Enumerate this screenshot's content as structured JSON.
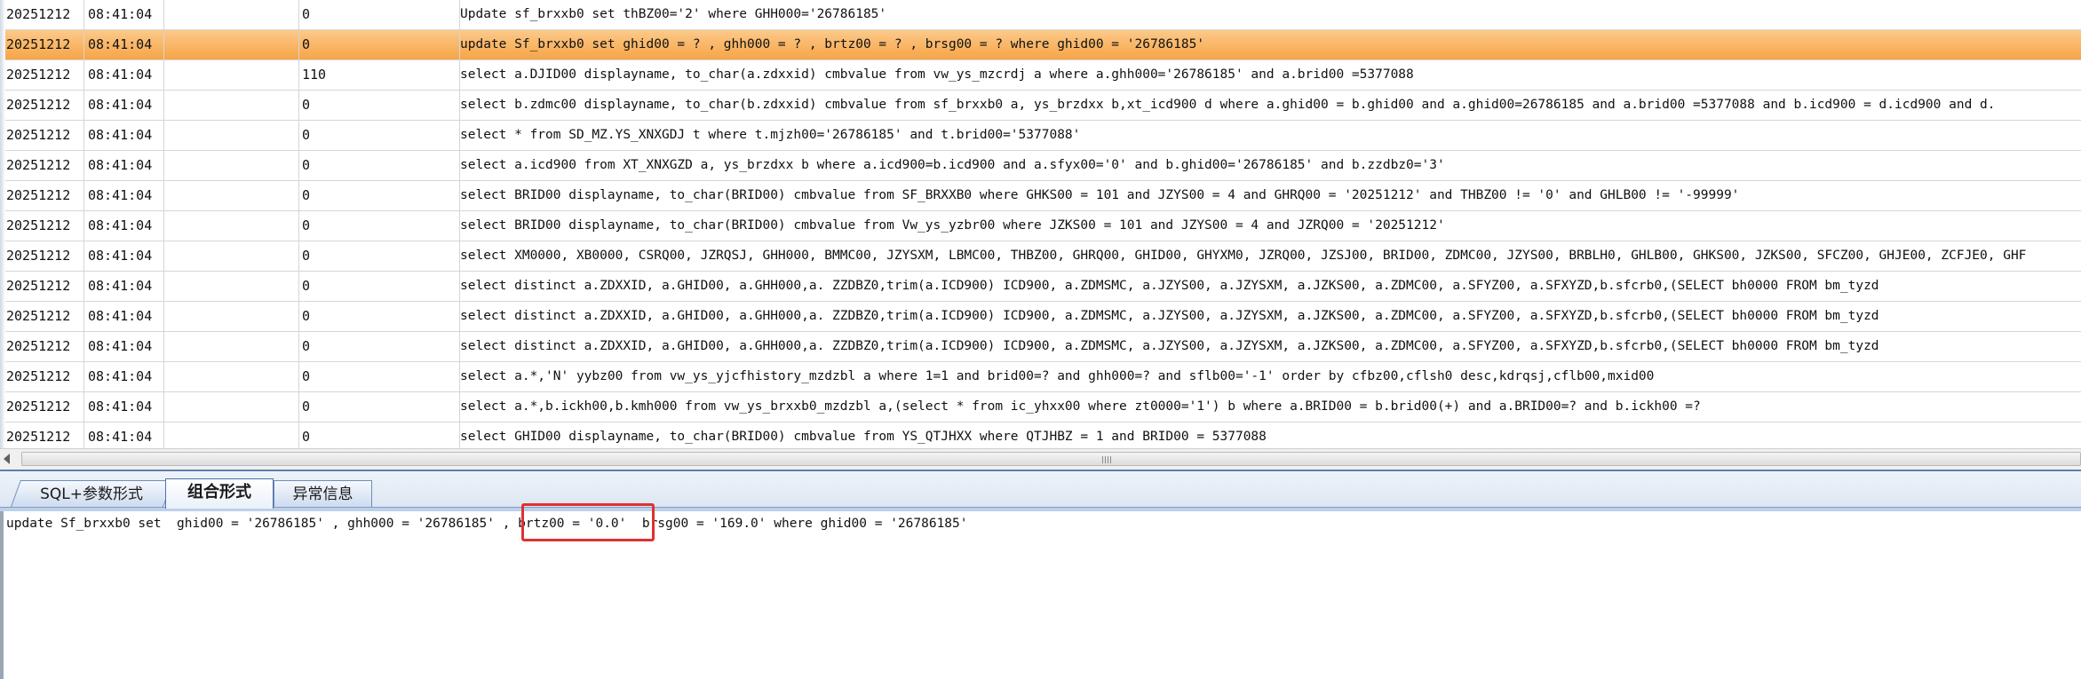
{
  "grid": {
    "rows": [
      {
        "date": "20251212",
        "time": "08:41:04",
        "blank": "",
        "cost": "0",
        "sql": " Update sf_brxxb0 set thBZ00='2' where GHH000='26786185'",
        "selected": false
      },
      {
        "date": "20251212",
        "time": "08:41:04",
        "blank": "",
        "cost": "0",
        "sql": "update Sf_brxxb0 set  ghid00 = ? , ghh000 = ? , brtz00 = ? , brsg00 = ? where ghid00 = '26786185'",
        "selected": true
      },
      {
        "date": "20251212",
        "time": "08:41:04",
        "blank": "",
        "cost": "110",
        "sql": "select a.DJID00  displayname, to_char(a.zdxxid)  cmbvalue from  vw_ys_mzcrdj a   where a.ghh000='26786185'  and  a.brid00 =5377088",
        "selected": false
      },
      {
        "date": "20251212",
        "time": "08:41:04",
        "blank": "",
        "cost": "0",
        "sql": "select b.zdmc00  displayname, to_char(b.zdxxid)  cmbvalue from  sf_brxxb0 a, ys_brzdxx b,xt_icd900 d   where a.ghid00 = b.ghid00 and a.ghid00=26786185 and a.brid00 =5377088 and b.icd900 = d.icd900 and d.",
        "selected": false
      },
      {
        "date": "20251212",
        "time": "08:41:04",
        "blank": "",
        "cost": "0",
        "sql": "select * from SD_MZ.YS_XNXGDJ t where t.mjzh00='26786185'  and t.brid00='5377088'",
        "selected": false
      },
      {
        "date": "20251212",
        "time": "08:41:04",
        "blank": "",
        "cost": "0",
        "sql": "select a.icd900 from XT_XNXGZD a, ys_brzdxx b where a.icd900=b.icd900 and a.sfyx00='0'  and b.ghid00='26786185'  and b.zzdbz0='3'",
        "selected": false
      },
      {
        "date": "20251212",
        "time": "08:41:04",
        "blank": "",
        "cost": "0",
        "sql": "select BRID00  displayname, to_char(BRID00)  cmbvalue from SF_BRXXB0   where GHKS00 = 101 and JZYS00 = 4 and GHRQ00 = '20251212'  and THBZ00 != '0'  and GHLB00 != '-99999'",
        "selected": false
      },
      {
        "date": "20251212",
        "time": "08:41:04",
        "blank": "",
        "cost": "0",
        "sql": "select BRID00  displayname, to_char(BRID00)  cmbvalue from Vw_ys_yzbr00   where JZKS00 = 101 and JZYS00 = 4 and JZRQ00 = '20251212'",
        "selected": false
      },
      {
        "date": "20251212",
        "time": "08:41:04",
        "blank": "",
        "cost": "0",
        "sql": " select XM0000, XB0000, CSRQ00, JZRQSJ, GHH000, BMMC00, JZYSXM, LBMC00, THBZ00, GHRQ00, GHID00, GHYXM0, JZRQ00, JZSJ00, BRID00, ZDMC00, JZYS00, BRBLH0, GHLB00, GHKS00, JZKS00, SFCZ00, GHJE00, ZCFJE0, GHF",
        "selected": false
      },
      {
        "date": "20251212",
        "time": "08:41:04",
        "blank": "",
        "cost": "0",
        "sql": " select distinct a.ZDXXID, a.GHID00, a.GHH000,a. ZZDBZ0,trim(a.ICD900) ICD900, a.ZDMSMC, a.JZYS00, a.JZYSXM, a.JZKS00, a.ZDMC00, a.SFYZ00, a.SFXYZD,b.sfcrb0,(SELECT bh0000                    FROM bm_tyzd",
        "selected": false
      },
      {
        "date": "20251212",
        "time": "08:41:04",
        "blank": "",
        "cost": "0",
        "sql": " select distinct a.ZDXXID, a.GHID00, a.GHH000,a. ZZDBZ0,trim(a.ICD900) ICD900, a.ZDMSMC, a.JZYS00, a.JZYSXM, a.JZKS00, a.ZDMC00, a.SFYZ00, a.SFXYZD,b.sfcrb0,(SELECT bh0000                    FROM bm_tyzd",
        "selected": false
      },
      {
        "date": "20251212",
        "time": "08:41:04",
        "blank": "",
        "cost": "0",
        "sql": " select distinct a.ZDXXID, a.GHID00, a.GHH000,a. ZZDBZ0,trim(a.ICD900) ICD900, a.ZDMSMC, a.JZYS00, a.JZYSXM, a.JZKS00, a.ZDMC00, a.SFYZ00, a.SFXYZD,b.sfcrb0,(SELECT bh0000                    FROM bm_tyzd",
        "selected": false
      },
      {
        "date": "20251212",
        "time": "08:41:04",
        "blank": "",
        "cost": "0",
        "sql": " select a.*,'N' yybz00 from vw_ys_yjcfhistory_mzdzbl a where 1=1  and brid00=?  and ghh000=?  and sflb00='-1' order by cfbz00,cflsh0 desc,kdrqsj,cflb00,mxid00",
        "selected": false
      },
      {
        "date": "20251212",
        "time": "08:41:04",
        "blank": "",
        "cost": "0",
        "sql": " select a.*,b.ickh00,b.kmh000 from vw_ys_brxxb0_mzdzbl a,(select * from ic_yhxx00 where zt0000='1') b where a.BRID00 = b.brid00(+)   and a.BRID00=?  and b.ickh00 =?",
        "selected": false
      },
      {
        "date": "20251212",
        "time": "08:41:04",
        "blank": "",
        "cost": "0",
        "sql": "select GHID00  displayname, to_char(BRID00)  cmbvalue from YS_QTJHXX   where QTJHBZ = 1 and BRID00 = 5377088",
        "selected": false
      }
    ]
  },
  "tabs": {
    "sql_params": "SQL+参数形式",
    "combined": "组合形式",
    "error_info": "异常信息"
  },
  "combined_sql": "update Sf_brxxb0 set  ghid00 = '26786185' , ghh000 = '26786185' , brtz00 = '0.0'  brsg00 = '169.0' where ghid00 = '26786185'",
  "colors": {
    "selected_row": "#f6a547",
    "highlight_box": "#e03030",
    "tab_border": "#5b7fb0"
  }
}
